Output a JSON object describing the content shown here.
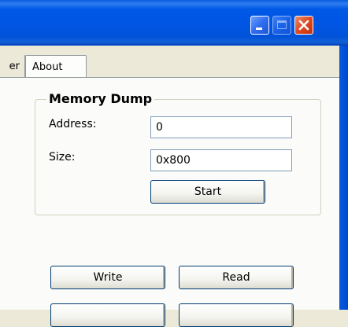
{
  "tabs": {
    "previous_partial": "er",
    "about": "About"
  },
  "memory_dump": {
    "title": "Memory Dump",
    "address_label": "Address:",
    "address_value": "0",
    "size_label": "Size:",
    "size_value": "0x800",
    "start_button": "Start"
  },
  "actions": {
    "write_button": "Write",
    "read_button": "Read"
  }
}
